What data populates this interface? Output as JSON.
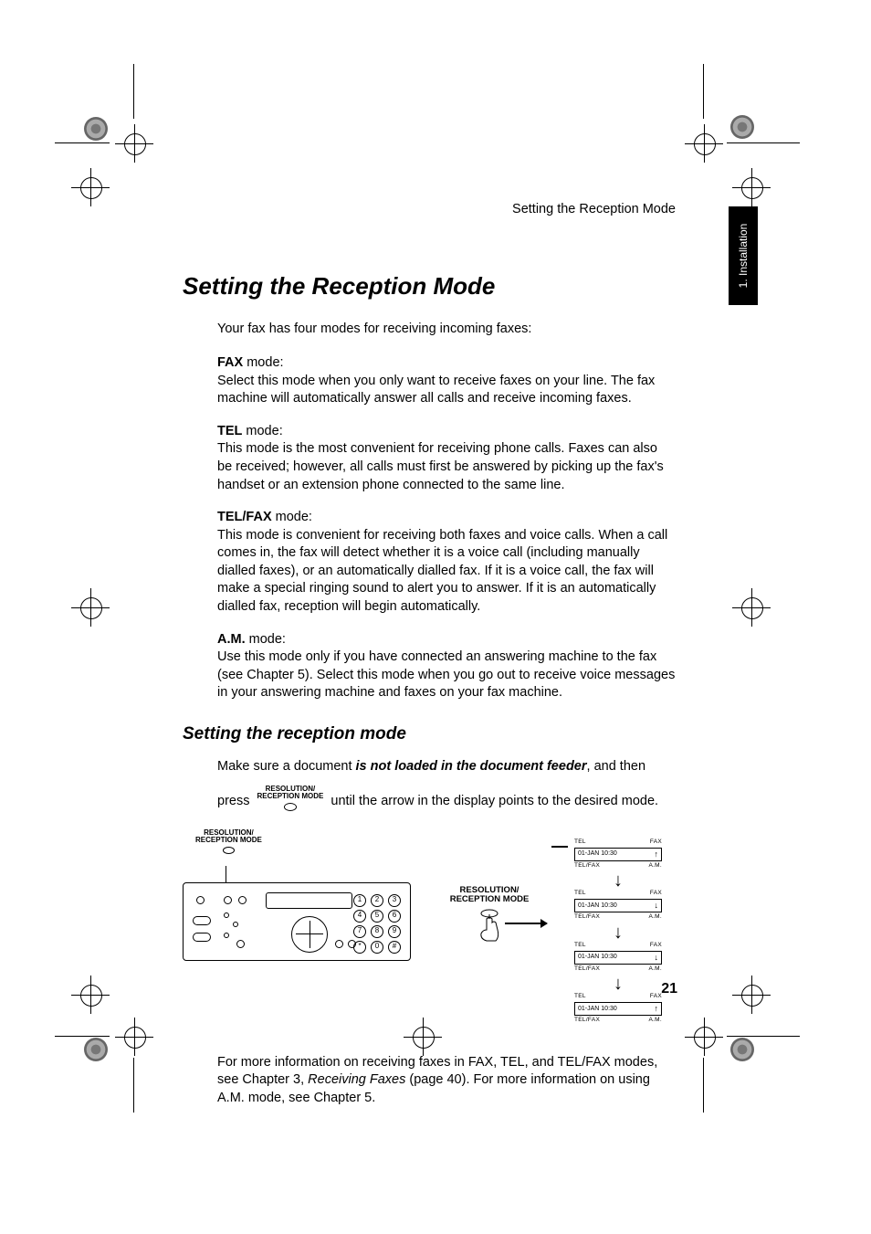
{
  "running_head": "Setting the Reception Mode",
  "side_tab": "1. Installation",
  "title": "Setting the Reception Mode",
  "intro": "Your fax has four modes for receiving incoming faxes:",
  "modes": [
    {
      "label": "FAX",
      "suffix": " mode:",
      "body": "Select this mode when you only want to receive faxes on your line. The fax machine will automatically answer all calls and receive incoming faxes."
    },
    {
      "label": "TEL",
      "suffix": " mode:",
      "body": "This mode is the most convenient for receiving phone calls. Faxes can also be received; however, all calls must first be answered by picking up the fax's handset or an extension phone connected to the same line."
    },
    {
      "label": "TEL/FAX",
      "suffix": " mode:",
      "body": "This mode is convenient for receiving both faxes and voice calls. When a call comes in, the fax will detect whether it is a voice call (including manually dialled faxes), or an automatically dialled fax. If it is a voice call, the fax will make a special ringing sound to alert you to answer. If it is an automatically dialled fax, reception will begin automatically."
    },
    {
      "label": "A.M.",
      "suffix": " mode:",
      "body": "Use this mode only if you have connected an answering machine to the fax (see Chapter 5). Select this mode when you go out to receive voice messages in your answering machine and faxes on your fax machine."
    }
  ],
  "sub_title": "Setting the reception mode",
  "step_prefix": "Make sure a document ",
  "step_bold_italic": "is not loaded in the document feeder",
  "step_suffix": ", and then",
  "press_word": "press",
  "button_line1": "RESOLUTION/",
  "button_line2": "RECEPTION MODE",
  "press_tail": " until the arrow in the display points to the desired mode.",
  "panel_button_label_line1": "RESOLUTION/",
  "panel_button_label_line2": "RECEPTION MODE",
  "mid_label_line1": "RESOLUTION/",
  "mid_label_line2": "RECEPTION MODE",
  "keypad": [
    "1",
    "2",
    "3",
    "4",
    "5",
    "6",
    "7",
    "8",
    "9",
    "*",
    "0",
    "#"
  ],
  "states": [
    {
      "top_left": "TEL",
      "top_right": "FAX",
      "text": "01-JAN 10:30",
      "arrow": "↑",
      "bottom_left": "TEL/FAX",
      "bottom_right": "A.M."
    },
    {
      "top_left": "TEL",
      "top_right": "FAX",
      "text": "01-JAN 10:30",
      "arrow": "↓",
      "bottom_left": "TEL/FAX",
      "bottom_right": "A.M."
    },
    {
      "top_left": "TEL",
      "top_right": "FAX",
      "text": "01-JAN 10:30",
      "arrow": "↓",
      "bottom_left": "TEL/FAX",
      "bottom_right": "A.M."
    },
    {
      "top_left": "TEL",
      "top_right": "FAX",
      "text": "01-JAN 10:30",
      "arrow": "↑",
      "bottom_left": "TEL/FAX",
      "bottom_right": "A.M."
    }
  ],
  "footer_para_1": "For more information on receiving faxes in FAX, TEL, and TEL/FAX modes, see Chapter 3, ",
  "footer_italic": "Receiving Faxes",
  "footer_para_2": " (page 40). For more information on using A.M. mode, see Chapter 5.",
  "page_number": "21"
}
